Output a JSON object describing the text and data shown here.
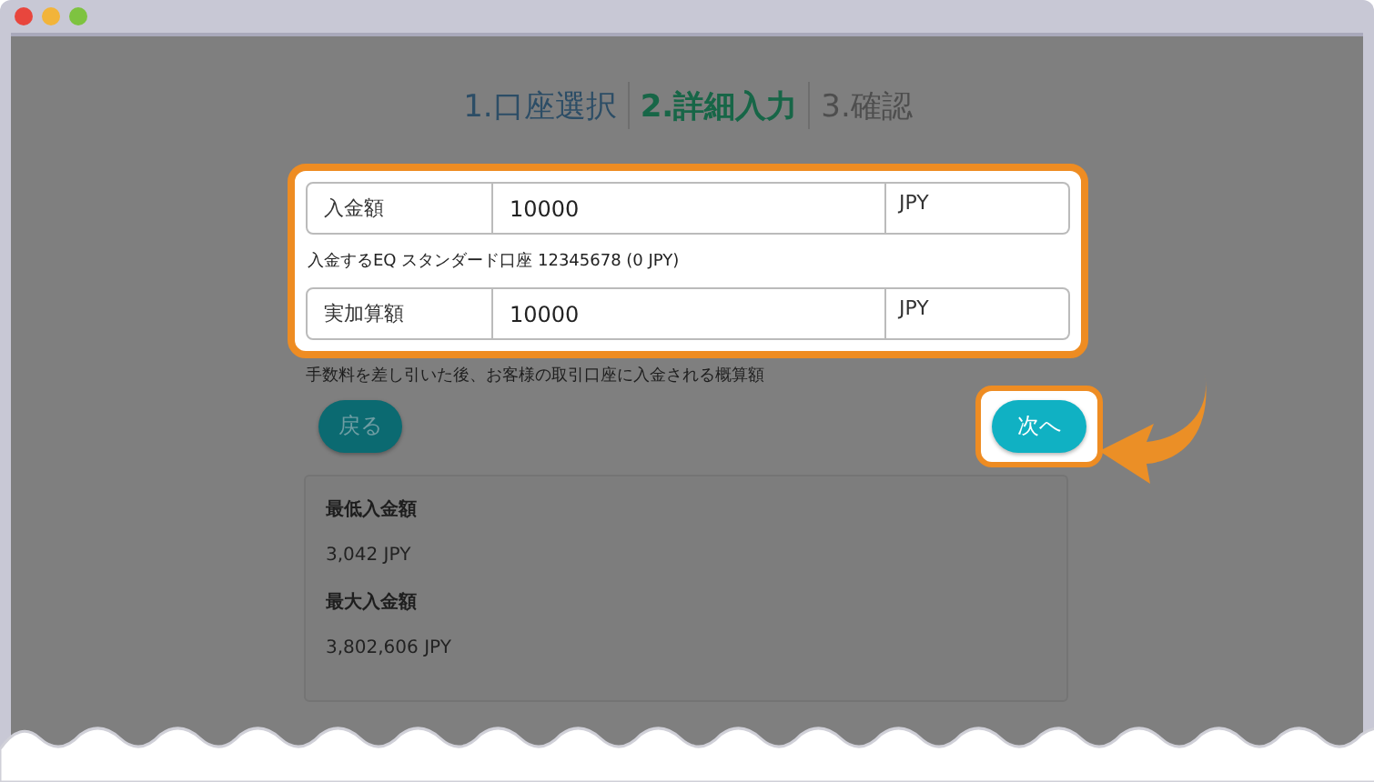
{
  "steps": [
    {
      "label": "1.口座選択",
      "selected": false,
      "done": true
    },
    {
      "label": "2.詳細入力",
      "selected": true,
      "done": false
    },
    {
      "label": "3.確認",
      "selected": false,
      "done": false
    }
  ],
  "form": {
    "highlighted": true,
    "amount": {
      "label": "入金額",
      "value": "10000",
      "currency": "JPY"
    },
    "account_note": "入金するEQ スタンダード口座 12345678 (0 JPY)",
    "actual": {
      "label": "実加算額",
      "value": "10000",
      "currency": "JPY"
    }
  },
  "fee_note": "手数料を差し引いた後、お客様の取引口座に入金される概算額",
  "back_button": {
    "label": "戻る",
    "highlighted": false
  },
  "next_button": {
    "label": "次へ",
    "highlighted": true
  },
  "limits": [
    {
      "title": "最低入金額",
      "value": "3,042 JPY"
    },
    {
      "title": "最大入金額",
      "value": "3,802,606 JPY"
    }
  ]
}
